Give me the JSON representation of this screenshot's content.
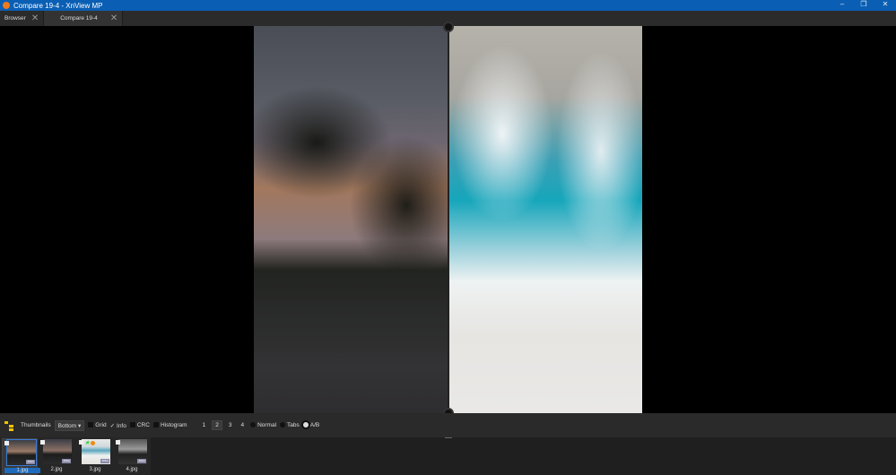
{
  "window": {
    "title": "Compare 19-4 - XnView MP",
    "controls": [
      "–",
      "❐",
      "✕"
    ]
  },
  "tabs": [
    {
      "label": "Browser"
    },
    {
      "label": "Compare 19-4"
    }
  ],
  "toolbar": {
    "thumbnails_label": "Thumbnails",
    "thumbnails_position": "Bottom",
    "grid": "Grid",
    "info": "Info",
    "crc": "CRC",
    "histogram": "Histogram",
    "counts": [
      "1",
      "2",
      "3",
      "4"
    ],
    "selected_count": "2",
    "normal": "Normal",
    "tabs": "Tabs",
    "ab": "A/B",
    "info_checked": true,
    "mode": "A/B"
  },
  "thumbnails": [
    {
      "label": "1.jpg",
      "selected": true
    },
    {
      "label": "2.jpg"
    },
    {
      "label": "3.jpg"
    },
    {
      "label": "4.jpg"
    }
  ]
}
